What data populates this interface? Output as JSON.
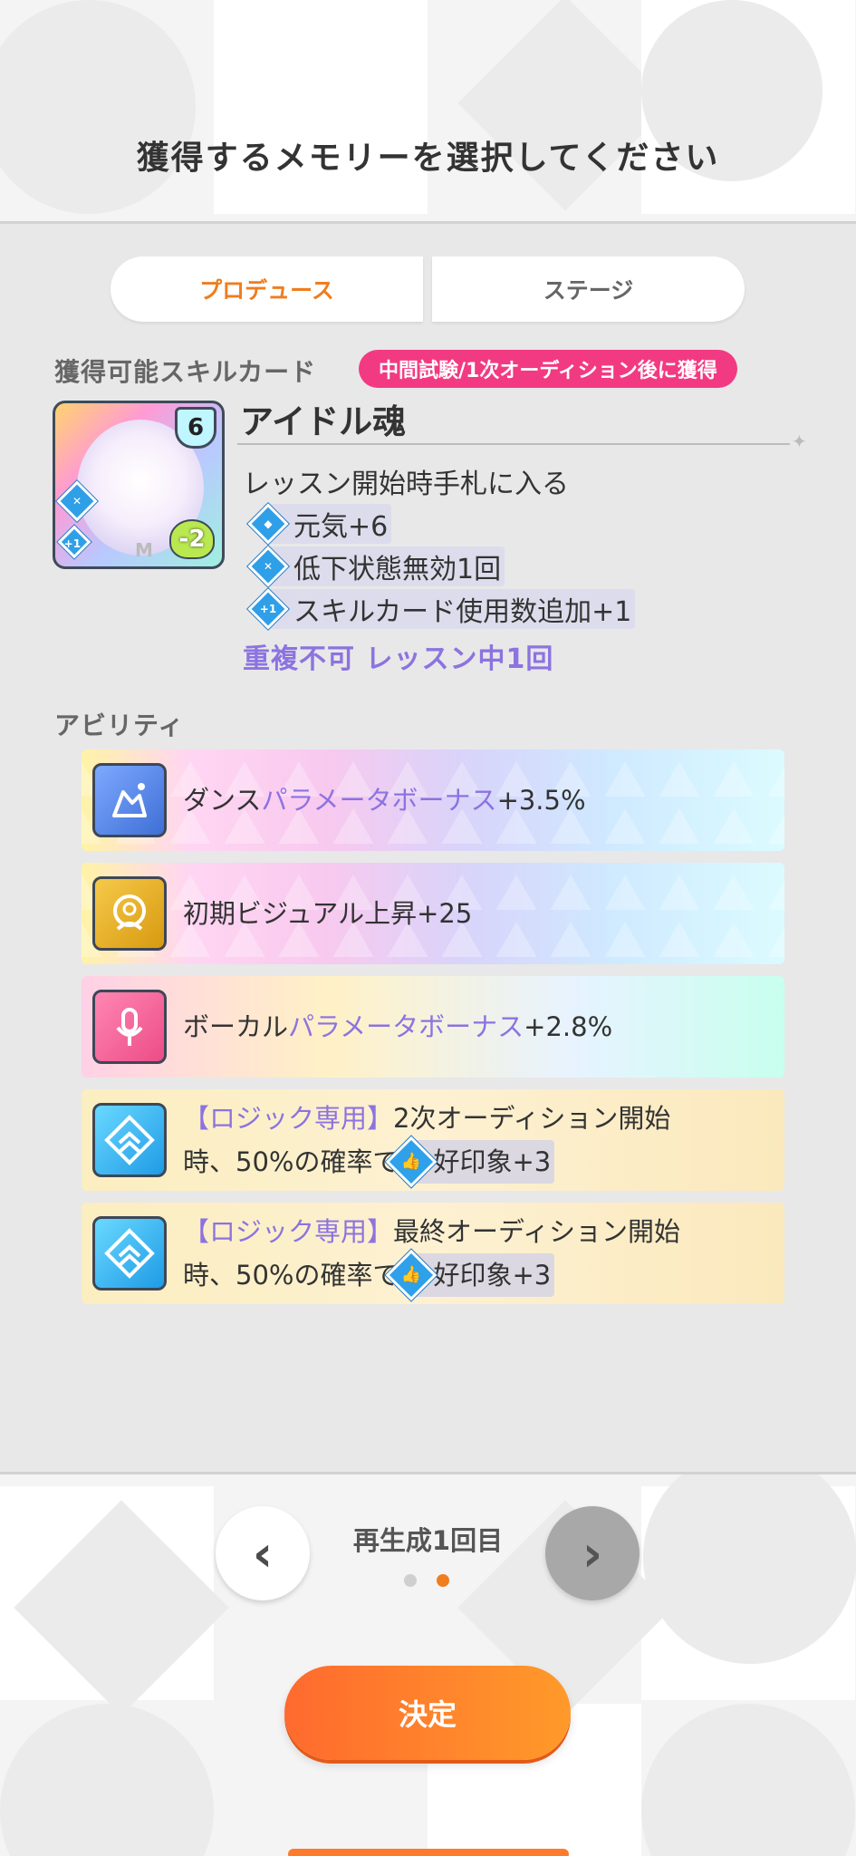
{
  "header": {
    "title": "獲得するメモリーを選択してください"
  },
  "tabs": [
    {
      "label": "プロデュース",
      "active": true
    },
    {
      "label": "ステージ",
      "active": false
    }
  ],
  "skill_section": {
    "label": "獲得可能スキルカード",
    "badge": "中間試験/1次オーディション後に獲得",
    "card": {
      "cost": "6",
      "heart_value": "-2",
      "rarity_mark": "M",
      "name": "アイドル魂",
      "effect_header": "レッスン開始時手札に入る",
      "effects": [
        {
          "icon": "shield-icon",
          "text": "元気+6"
        },
        {
          "icon": "cancel-debuff-icon",
          "text": "低下状態無効1回"
        },
        {
          "icon": "plus-one-icon",
          "text": "スキルカード使用数追加+1"
        }
      ],
      "note": "重複不可 レッスン中1回"
    }
  },
  "ability_section": {
    "label": "アビリティ",
    "items": [
      {
        "icon": "dance-icon",
        "plain": "ダンス",
        "purple": "パラメータボーナス",
        "suffix": "+3.5%"
      },
      {
        "icon": "visual-icon",
        "plain": "初期ビジュアル上昇+25"
      },
      {
        "icon": "microphone-icon",
        "plain": "ボーカル",
        "purple": "パラメータボーナス",
        "suffix": "+2.8%"
      },
      {
        "icon": "logic-icon",
        "purple": "【ロジック専用】",
        "plain": "2次オーディション開始",
        "line2": "時、50%の確率で",
        "chip": "好印象+3"
      },
      {
        "icon": "logic-icon",
        "purple": "【ロジック専用】",
        "plain": "最終オーディション開始",
        "line2": "時、50%の確率で",
        "chip": "好印象+3"
      }
    ]
  },
  "pager": {
    "label": "再生成1回目",
    "total_pages": 2,
    "current_page": 2
  },
  "confirm_button": {
    "label": "決定"
  }
}
